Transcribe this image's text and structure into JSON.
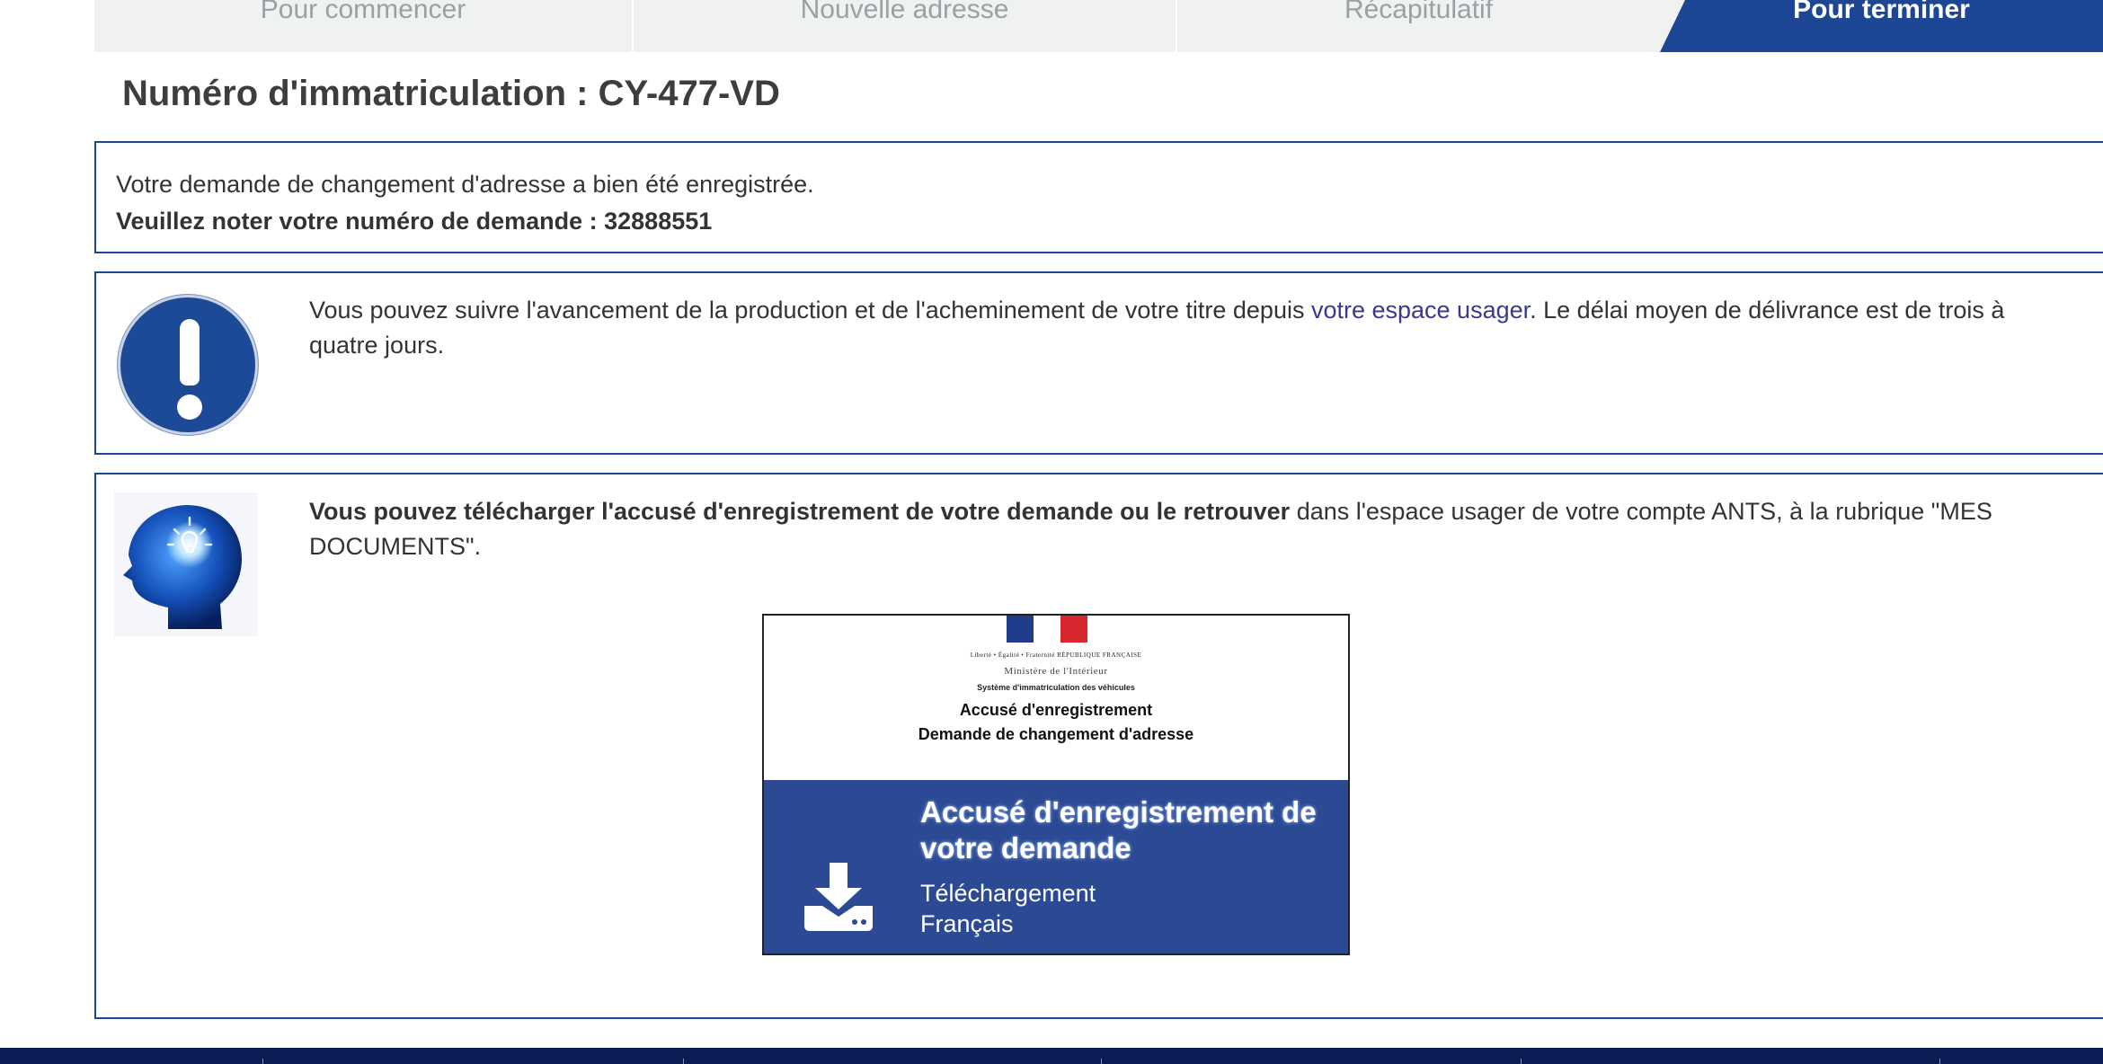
{
  "stepper": {
    "steps": [
      {
        "label": "Pour commencer"
      },
      {
        "label": "Nouvelle adresse"
      },
      {
        "label": "Récapitulatif"
      },
      {
        "label": "Pour terminer"
      }
    ],
    "active_color": "#1d4695"
  },
  "page_title": "Numéro d'immatriculation : CY-477-VD",
  "confirmation": {
    "line1": "Votre demande de changement d'adresse a bien été enregistrée.",
    "line2": "Veuillez noter votre numéro de demande : 32888551"
  },
  "info_box": {
    "icon": "exclamation-icon",
    "text_before": "Vous pouvez suivre l'avancement de la production et de l'acheminement de votre titre depuis ",
    "link": "votre espace usager",
    "text_after": ". Le délai moyen de délivrance est de trois à quatre jours."
  },
  "download_box": {
    "icon": "head-lightbulb-icon",
    "bold_text": "Vous pouvez télécharger l'accusé d'enregistrement de votre demande ou le retrouver",
    "text_after": " dans l'espace usager de votre compte ANTS, à la rubrique \"MES DOCUMENTS\".",
    "card": {
      "flag_caption": "Liberté • Égalité • Fraternité  RÉPUBLIQUE FRANÇAISE",
      "ministere": "Ministère de l'Intérieur",
      "systeme": "Système d'immatriculation des véhicules",
      "preview_title": "Accusé d'enregistrement",
      "preview_subtitle": "Demande de changement d'adresse",
      "title": "Accusé d'enregistrement de votre demande",
      "action": "Téléchargement",
      "language": "Français",
      "icon": "download-icon"
    }
  },
  "colors": {
    "primary": "#1d4695",
    "card_blue": "#2c4a93",
    "footer": "#0c1c55"
  }
}
